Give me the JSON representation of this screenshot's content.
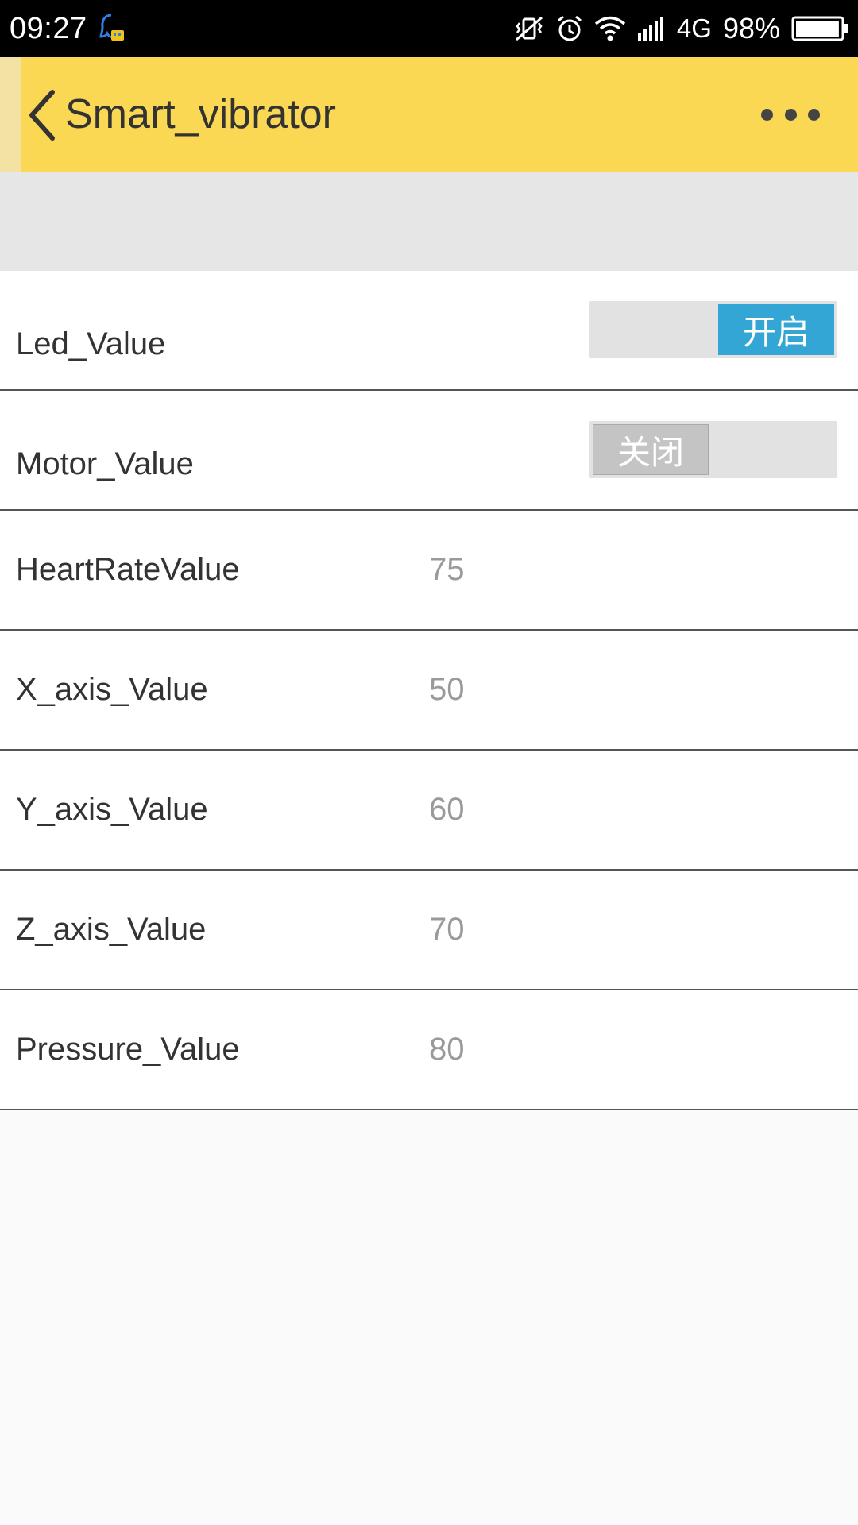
{
  "status_bar": {
    "time": "09:27",
    "network": "4G",
    "battery_percent": "98%",
    "battery_level": 0.98,
    "icons": [
      "notification-app-icon",
      "vibrate-mute-icon",
      "alarm-icon",
      "wifi-icon",
      "signal-icon",
      "battery-icon"
    ]
  },
  "app_bar": {
    "title": "Smart_vibrator",
    "back_icon": "chevron-left-icon",
    "more_icon": "more-horizontal-icon",
    "background_color": "#fad853"
  },
  "rows": [
    {
      "label": "Led_Value",
      "type": "switch",
      "state": "on",
      "switch_text": "开启"
    },
    {
      "label": "Motor_Value",
      "type": "switch",
      "state": "off",
      "switch_text": "关闭"
    },
    {
      "label": "HeartRateValue",
      "type": "value",
      "value": "75"
    },
    {
      "label": "X_axis_Value",
      "type": "value",
      "value": "50"
    },
    {
      "label": "Y_axis_Value",
      "type": "value",
      "value": "60"
    },
    {
      "label": "Z_axis_Value",
      "type": "value",
      "value": "70"
    },
    {
      "label": "Pressure_Value",
      "type": "value",
      "value": "80"
    }
  ],
  "colors": {
    "switch_on": "#33a6d6",
    "switch_off": "#c4c4c4"
  }
}
